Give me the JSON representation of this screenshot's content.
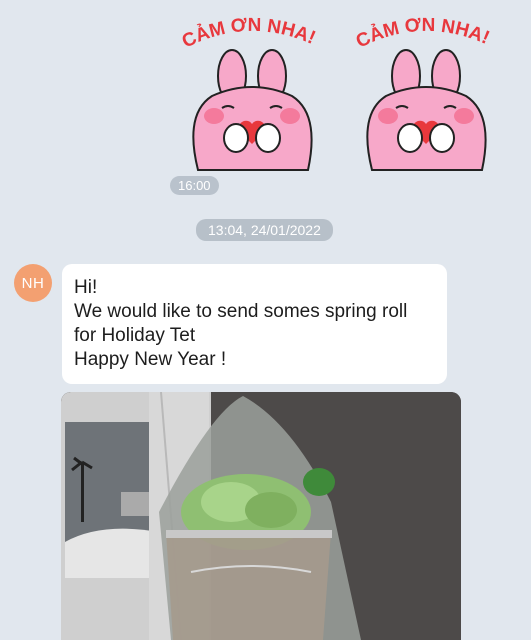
{
  "stickers": [
    {
      "caption": "CẢM ƠN NHA!",
      "icon": "bunny-heart-sticker"
    },
    {
      "caption": "CẢM ƠN NHA!",
      "icon": "bunny-heart-sticker"
    }
  ],
  "sticker_time": "16:00",
  "date_separator": "13:04, 24/01/2022",
  "message": {
    "avatar_initials": "NH",
    "avatar_color": "#f3a071",
    "lines": [
      "Hi!",
      "We would like to send somes spring roll",
      "for Holiday Tet",
      "Happy New Year !"
    ]
  },
  "photo": {
    "icon": "spring-roll-photo"
  }
}
